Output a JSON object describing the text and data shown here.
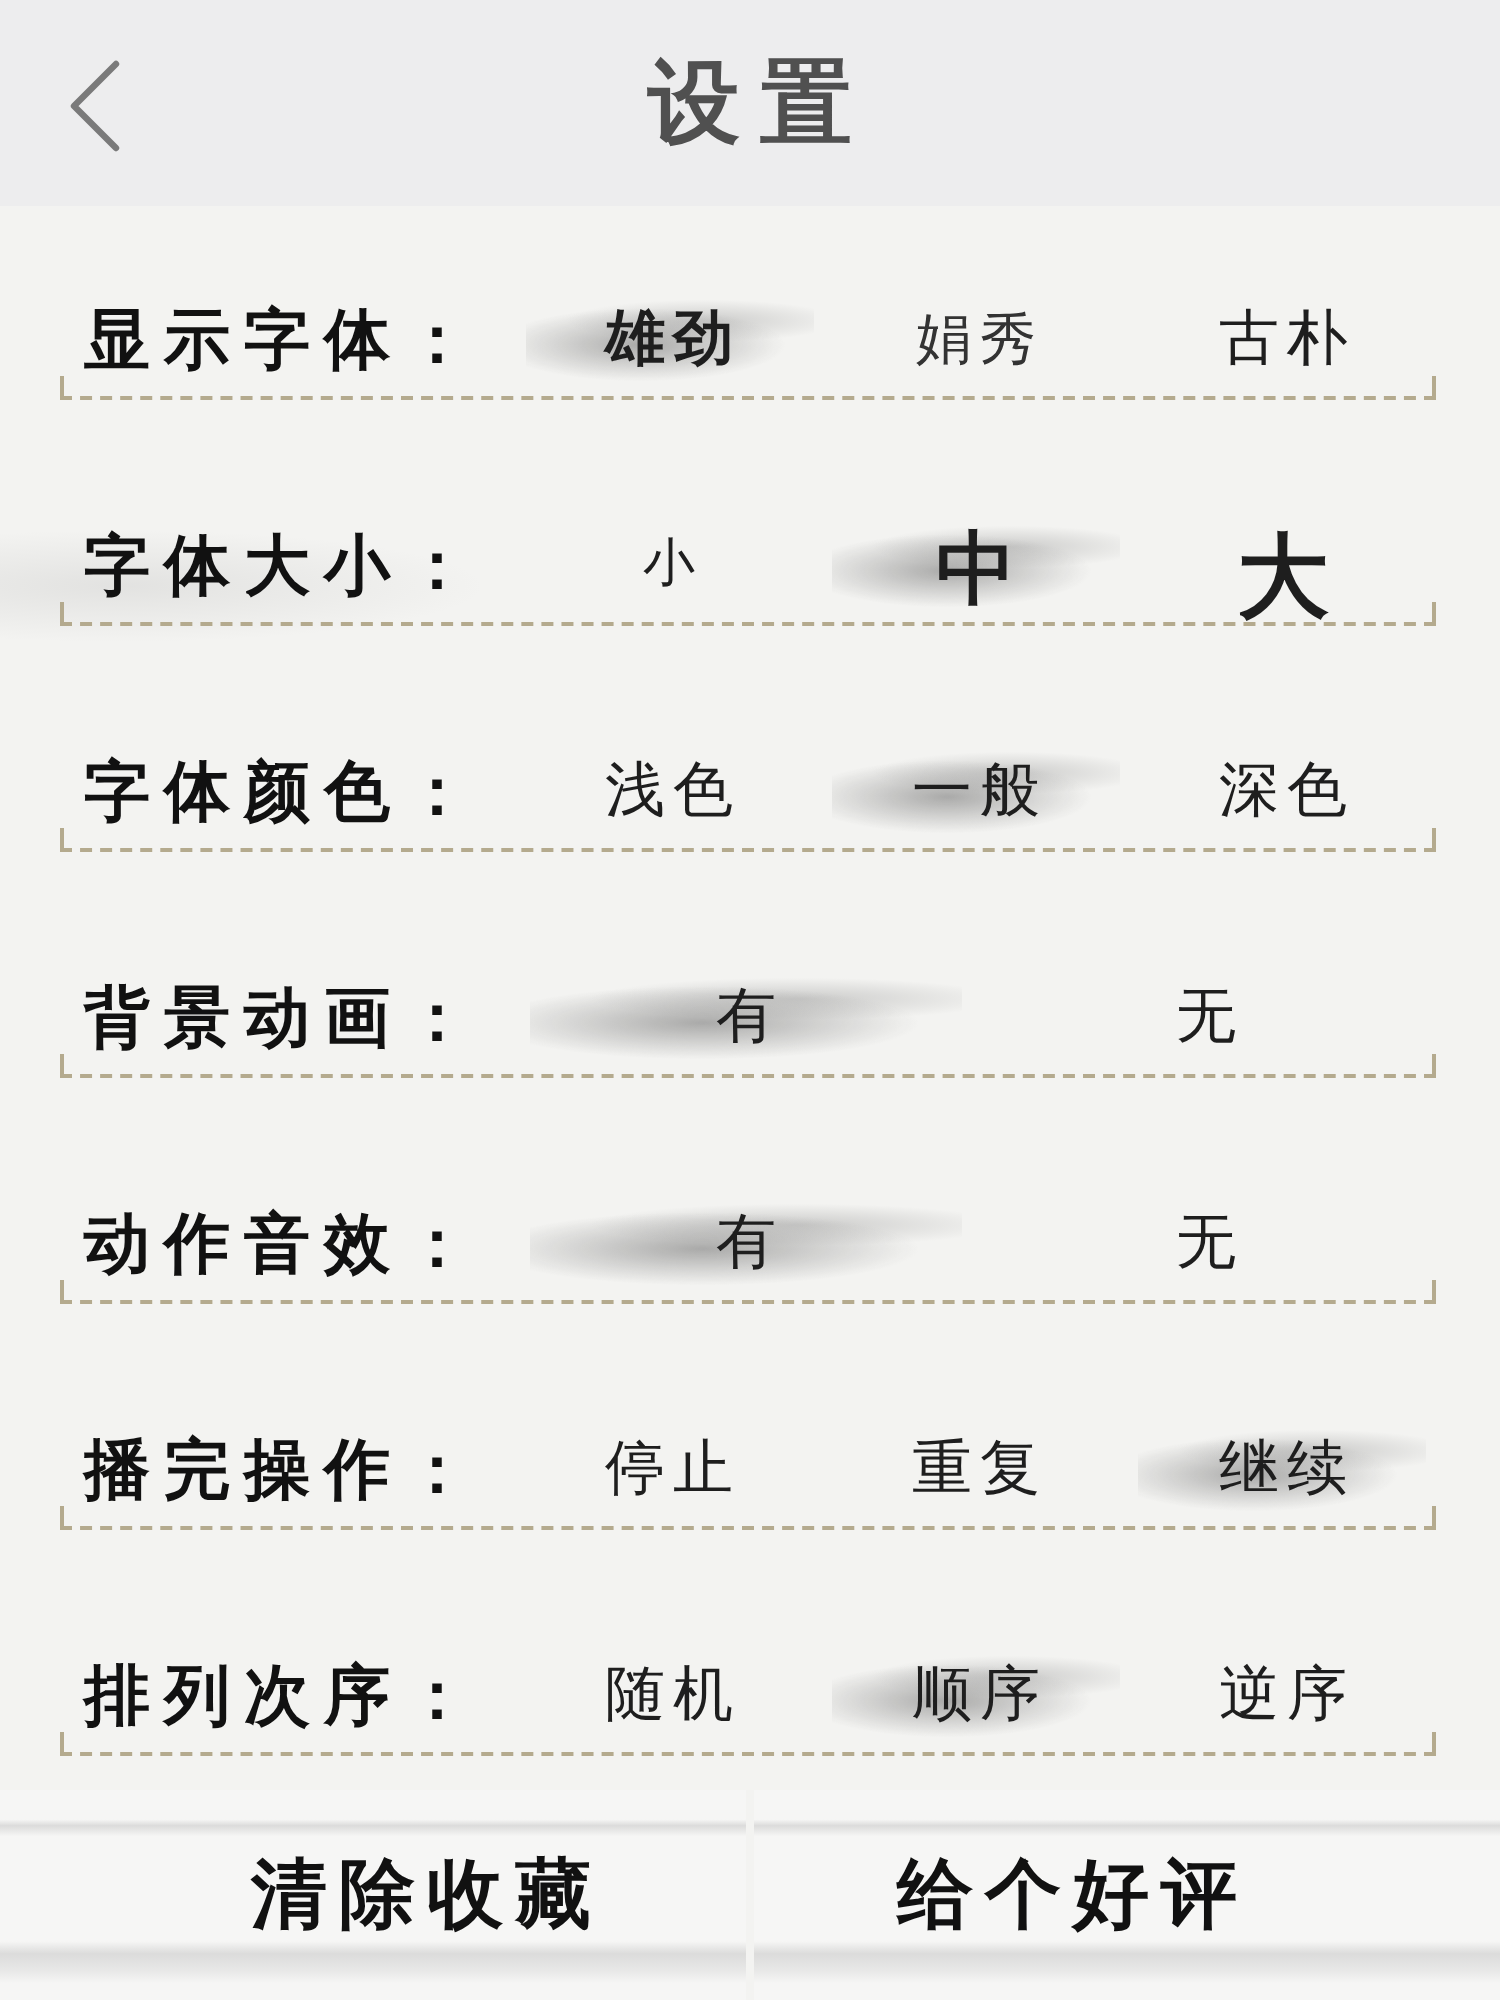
{
  "header": {
    "title": "设置"
  },
  "settings": [
    {
      "label": "显示字体：",
      "options": [
        {
          "text": "雄劲",
          "selected": true,
          "kind": "bold"
        },
        {
          "text": "娟秀",
          "selected": false,
          "kind": "light"
        },
        {
          "text": "古朴",
          "selected": false,
          "kind": "regular"
        }
      ]
    },
    {
      "label": "字体大小：",
      "options": [
        {
          "text": "小",
          "selected": false,
          "kind": "small"
        },
        {
          "text": "中",
          "selected": true,
          "kind": "medium"
        },
        {
          "text": "大",
          "selected": false,
          "kind": "large"
        }
      ]
    },
    {
      "label": "字体颜色：",
      "options": [
        {
          "text": "浅色",
          "selected": false
        },
        {
          "text": "一般",
          "selected": true
        },
        {
          "text": "深色",
          "selected": false
        }
      ]
    },
    {
      "label": "背景动画：",
      "options": [
        {
          "text": "有",
          "selected": true
        },
        {
          "text": "无",
          "selected": false
        }
      ]
    },
    {
      "label": "动作音效：",
      "options": [
        {
          "text": "有",
          "selected": true
        },
        {
          "text": "无",
          "selected": false
        }
      ]
    },
    {
      "label": "播完操作：",
      "options": [
        {
          "text": "停止",
          "selected": false
        },
        {
          "text": "重复",
          "selected": false
        },
        {
          "text": "继续",
          "selected": true
        }
      ]
    },
    {
      "label": "排列次序：",
      "options": [
        {
          "text": "随机",
          "selected": false
        },
        {
          "text": "顺序",
          "selected": true
        },
        {
          "text": "逆序",
          "selected": false
        }
      ]
    }
  ],
  "footer_buttons": [
    "清除收藏",
    "给个好评"
  ]
}
